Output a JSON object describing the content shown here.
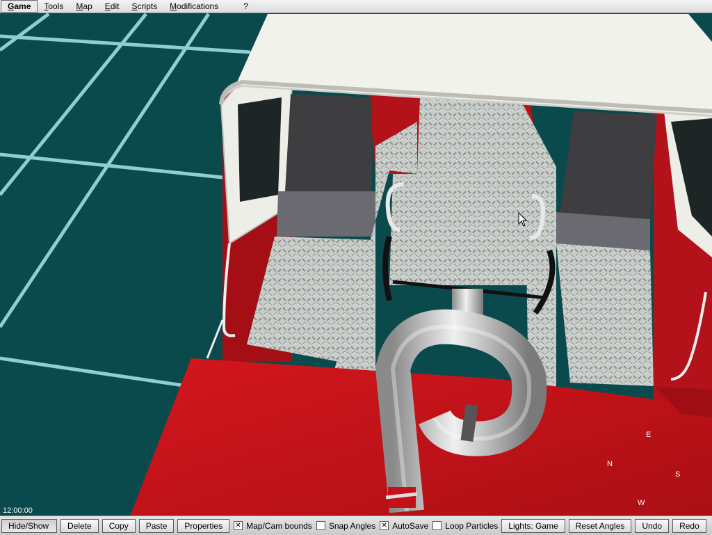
{
  "menu": {
    "items": [
      "Game",
      "Tools",
      "Map",
      "Edit",
      "Scripts",
      "Modifications",
      "?"
    ]
  },
  "viewport": {
    "clock": "12:00:00",
    "compass": {
      "north": "N",
      "east": "E",
      "south": "S",
      "west": "W"
    }
  },
  "toolbar": {
    "hide_show": "Hide/Show",
    "delete": "Delete",
    "copy": "Copy",
    "paste": "Paste",
    "properties": "Properties",
    "map_cam_bounds": {
      "label": "Map/Cam bounds",
      "checked": true
    },
    "snap_angles": {
      "label": "Snap Angles",
      "checked": false
    },
    "autosave": {
      "label": "AutoSave",
      "checked": true
    },
    "loop_particles": {
      "label": "Loop Particles",
      "checked": false
    },
    "lights": "Lights: Game",
    "reset_angles": "Reset Angles",
    "undo": "Undo",
    "redo": "Redo"
  },
  "colors": {
    "ground": "#0a4a4c",
    "grid": "#9fdede",
    "truck_red": "#c0141a",
    "roof_white": "#f2f2ec"
  }
}
